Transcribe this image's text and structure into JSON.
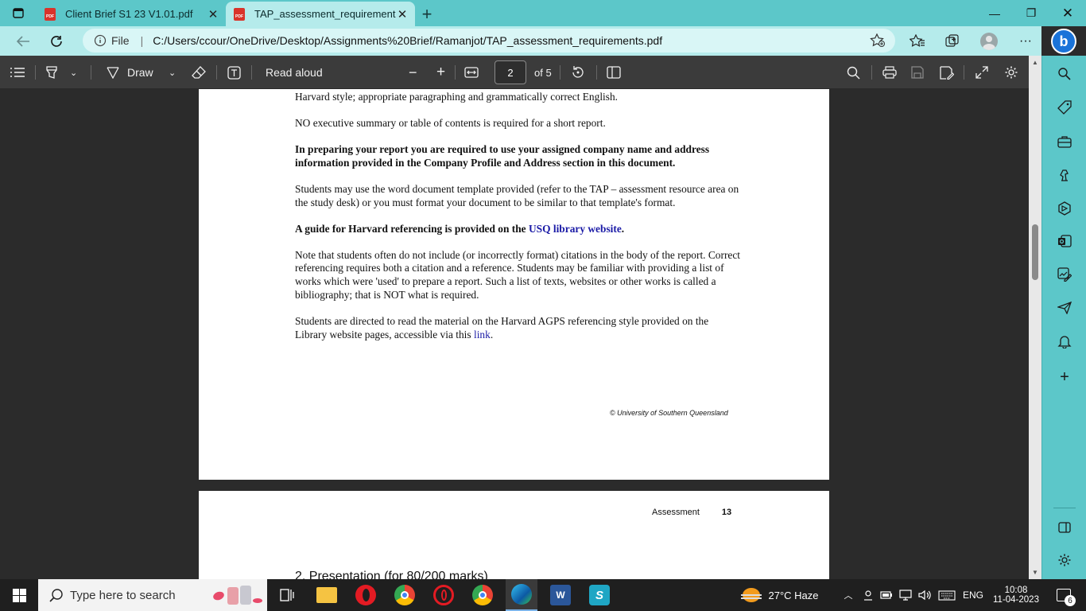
{
  "browser": {
    "tabs": [
      {
        "title": "Client Brief S1 23 V1.01.pdf",
        "badge": "PDF",
        "close": "✕",
        "active": false
      },
      {
        "title": "TAP_assessment_requirements.pdf",
        "badge": "PDF",
        "close": "✕",
        "active": true
      }
    ],
    "new_tab_label": "+",
    "window_controls": {
      "minimize": "—",
      "restore": "❐",
      "close": "✕"
    },
    "address": {
      "file_label": "File",
      "url": "C:/Users/ccour/OneDrive/Desktop/Assignments%20Brief/Ramanjot/TAP_assessment_requirements.pdf"
    },
    "more_label": "···",
    "bing_label": "b"
  },
  "pdf_toolbar": {
    "draw_label": "Draw",
    "read_aloud_label": "Read aloud",
    "zoom_out": "−",
    "zoom_in": "+",
    "current_page": "2",
    "page_of": "of 5"
  },
  "document": {
    "paragraphs": {
      "p1": "Harvard style; appropriate paragraphing and grammatically correct English.",
      "p2": "NO executive summary or table of contents is required for a short report.",
      "p3": "In preparing your report you are required to use your assigned company name and address information provided in the Company Profile and Address section in this document.",
      "p4": "Students may use the word document template provided (refer to the TAP – assessment resource area on the study desk) or you must format your document to be similar to that template's format.",
      "p5_text": "A guide for Harvard referencing is provided on the ",
      "p5_link": "USQ library website",
      "p5_end": ".",
      "p6": "Note that students often do not include (or incorrectly format) citations in the body of the report. Correct referencing requires both a citation and a reference. Students may be familiar with providing a list of works which were 'used' to prepare a report. Such a list of texts, websites or other works is called a bibliography; that is NOT what is required.",
      "p7_text": "Students are directed to read the material on the Harvard AGPS referencing style provided on the Library website pages, accessible via this ",
      "p7_link": "link",
      "p7_end": "."
    },
    "copyright": "© University of Southern Queensland",
    "page2": {
      "header_label": "Assessment",
      "header_number": "13",
      "section_heading": "2. Presentation (for 80/200 marks)"
    }
  },
  "taskbar": {
    "search_placeholder": "Type here to search",
    "weather": "27°C  Haze",
    "language": "ENG",
    "time": "10:08",
    "date": "11-04-2023",
    "notifications": "6"
  }
}
